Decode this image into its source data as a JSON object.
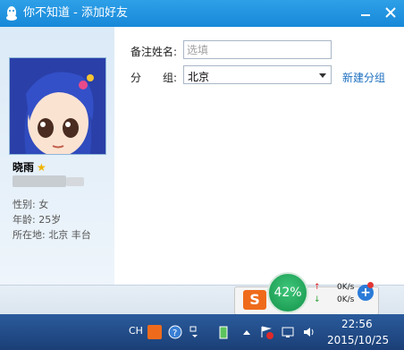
{
  "window": {
    "title": "你不知道 - 添加好友",
    "icons": {
      "app": "qq-penguin-icon",
      "minimize": "minimize-icon",
      "close": "close-icon"
    }
  },
  "profile": {
    "nickname": "晓雨",
    "star_icon": "star-icon",
    "gender": "性别: 女",
    "age": "年龄: 25岁",
    "location": "所在地: 北京  丰台"
  },
  "form": {
    "remark_label": "备注姓名:",
    "remark_placeholder": "选填",
    "group_label_1": "分",
    "group_label_2": "组:",
    "group_value": "北京",
    "new_group_link": "新建分组"
  },
  "widget": {
    "percent": "42%",
    "upload_speed": "0K/s",
    "download_speed": "0K/s",
    "up_arrow": "↑",
    "down_arrow": "↓"
  },
  "taskbar": {
    "ime": "CH",
    "time": "22:56",
    "date": "2015/10/25"
  },
  "colors": {
    "titlebar": "#1e90dc",
    "link": "#1d6fc0",
    "taskbar": "#1f4a86",
    "speed_circle": "#1fa85a"
  }
}
